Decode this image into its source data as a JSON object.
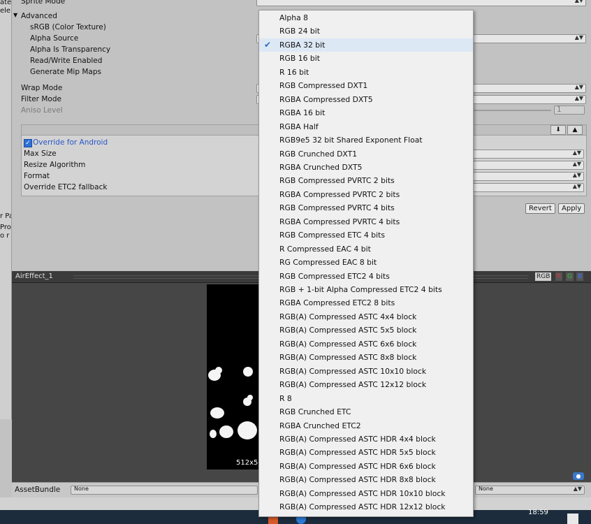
{
  "left_strip": [
    "ate",
    "ele",
    "r Pa",
    "Pro",
    "o r"
  ],
  "inspector": {
    "sprite_mode_label": "Sprite Mode",
    "advanced_label": "Advanced",
    "srgb_label": "sRGB (Color Texture)",
    "alpha_source_label": "Alpha Source",
    "alpha_transparency_label": "Alpha Is Transparency",
    "read_write_label": "Read/Write Enabled",
    "mipmaps_label": "Generate Mip Maps",
    "wrap_mode_label": "Wrap Mode",
    "filter_mode_label": "Filter Mode",
    "aniso_label": "Aniso Level",
    "aniso_value": "1"
  },
  "platform": {
    "override_label": "Override for Android",
    "max_size_label": "Max Size",
    "resize_label": "Resize Algorithm",
    "format_label": "Format",
    "etc2_label": "Override ETC2 fallback"
  },
  "buttons": {
    "revert": "Revert",
    "apply": "Apply"
  },
  "preview": {
    "asset_name": "AirEffect_1",
    "channels": [
      "RGB",
      "R",
      "G",
      "B"
    ],
    "size_text": "512x5"
  },
  "assetbundle": {
    "label": "AssetBundle",
    "name_value": "None",
    "variant_value": "None"
  },
  "taskbar": {
    "clock": "18:59"
  },
  "dropdown": {
    "selected_index": 2,
    "options": [
      "Alpha 8",
      "RGB 24 bit",
      "RGBA 32 bit",
      "RGB 16 bit",
      "R 16 bit",
      "RGB Compressed DXT1",
      "RGBA Compressed DXT5",
      "RGBA 16 bit",
      "RGBA Half",
      "RGB9e5 32 bit Shared Exponent Float",
      "RGB Crunched DXT1",
      "RGBA Crunched DXT5",
      "RGB Compressed PVRTC 2 bits",
      "RGBA Compressed PVRTC 2 bits",
      "RGB Compressed PVRTC 4 bits",
      "RGBA Compressed PVRTC 4 bits",
      "RGB Compressed ETC 4 bits",
      "R Compressed EAC 4 bit",
      "RG Compressed EAC 8 bit",
      "RGB Compressed ETC2 4 bits",
      "RGB + 1-bit Alpha Compressed ETC2 4 bits",
      "RGBA Compressed ETC2 8 bits",
      "RGB(A) Compressed ASTC 4x4 block",
      "RGB(A) Compressed ASTC 5x5 block",
      "RGB(A) Compressed ASTC 6x6 block",
      "RGB(A) Compressed ASTC 8x8 block",
      "RGB(A) Compressed ASTC 10x10 block",
      "RGB(A) Compressed ASTC 12x12 block",
      "R 8",
      "RGB Crunched ETC",
      "RGBA Crunched ETC2",
      "RGB(A) Compressed ASTC HDR 4x4 block",
      "RGB(A) Compressed ASTC HDR 5x5 block",
      "RGB(A) Compressed ASTC HDR 6x6 block",
      "RGB(A) Compressed ASTC HDR 8x8 block",
      "RGB(A) Compressed ASTC HDR 10x10 block",
      "RGB(A) Compressed ASTC HDR 12x12 block"
    ]
  }
}
